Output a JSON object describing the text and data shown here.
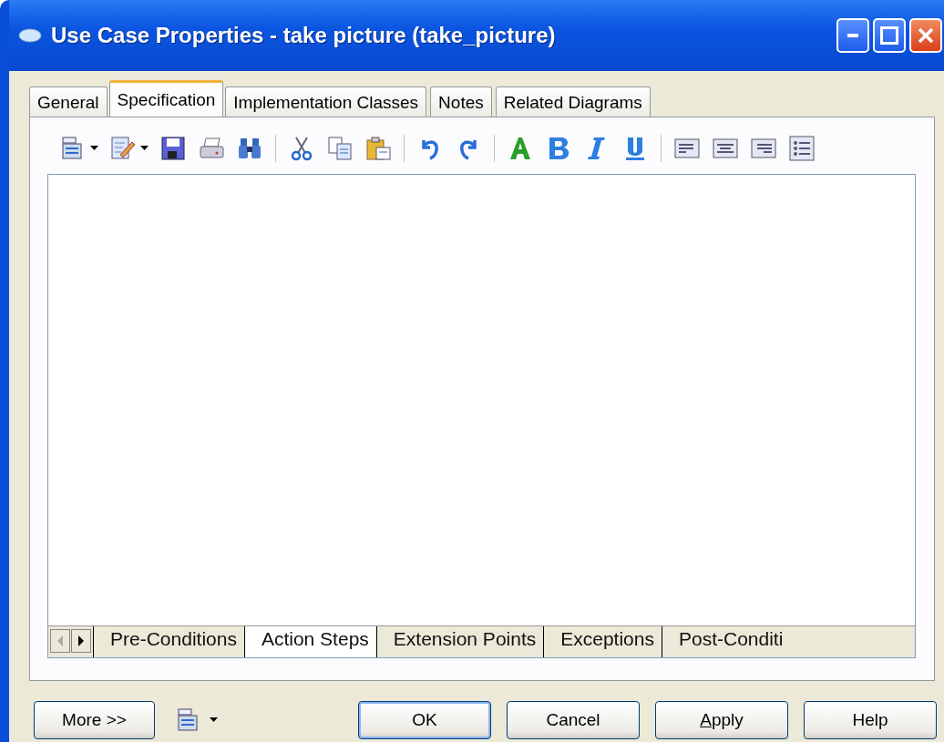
{
  "window": {
    "title": "Use Case Properties - take picture (take_picture)"
  },
  "tabs": [
    {
      "label": "General",
      "selected": false
    },
    {
      "label": "Specification",
      "selected": true
    },
    {
      "label": "Implementation Classes",
      "selected": false
    },
    {
      "label": "Notes",
      "selected": false
    },
    {
      "label": "Related Diagrams",
      "selected": false
    }
  ],
  "sheet_tabs": [
    {
      "label": "Pre-Conditions",
      "selected": false
    },
    {
      "label": "Action Steps",
      "selected": true
    },
    {
      "label": "Extension Points",
      "selected": false
    },
    {
      "label": "Exceptions",
      "selected": false
    },
    {
      "label": "Post-Conditi",
      "selected": false
    }
  ],
  "buttons": [
    {
      "label": "OK",
      "default": true,
      "underline_first": false
    },
    {
      "label": "Cancel",
      "default": false,
      "underline_first": false
    },
    {
      "label": "Apply",
      "default": false,
      "underline_first": true
    },
    {
      "label": "Help",
      "default": false,
      "underline_first": false
    }
  ],
  "more_button": {
    "label": "More >>"
  }
}
